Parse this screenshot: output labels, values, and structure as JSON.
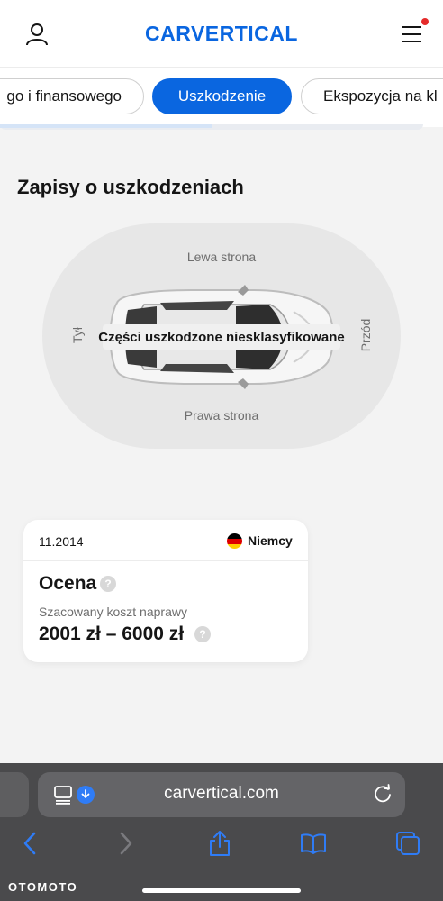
{
  "header": {
    "logo": "CARVERTICAL",
    "icons": {
      "profile": "person-icon",
      "menu": "hamburger-menu-icon"
    },
    "notification_color": "#e52a2a"
  },
  "tabs": [
    {
      "label": "go i finansowego"
    },
    {
      "label": "Uszkodzenie",
      "active": true
    },
    {
      "label": "Ekspozycja na kl"
    }
  ],
  "damage": {
    "title": "Zapisy o uszkodzeniach",
    "sides": {
      "left": "Lewa strona",
      "right": "Prawa strona",
      "rear": "Tył",
      "front": "Przód"
    },
    "damaged_parts_label": "Części uszkodzone niesklasyfikowane"
  },
  "record": {
    "date": "11.2014",
    "country": "Niemcy",
    "heading": "Ocena",
    "cost_label": "Szacowany koszt naprawy",
    "cost_range": "2001 zł – 6000 zł",
    "help_glyph": "?"
  },
  "browser": {
    "url": "carvertical.com",
    "icons": [
      "reader-mode-icon",
      "download-icon",
      "reload-icon",
      "back-icon",
      "forward-icon",
      "share-icon",
      "bookmarks-icon",
      "tabs-icon"
    ]
  },
  "watermark": "OTOMOTO",
  "colors": {
    "accent": "#0a66e0",
    "browser_accent": "#2f7cf6"
  }
}
